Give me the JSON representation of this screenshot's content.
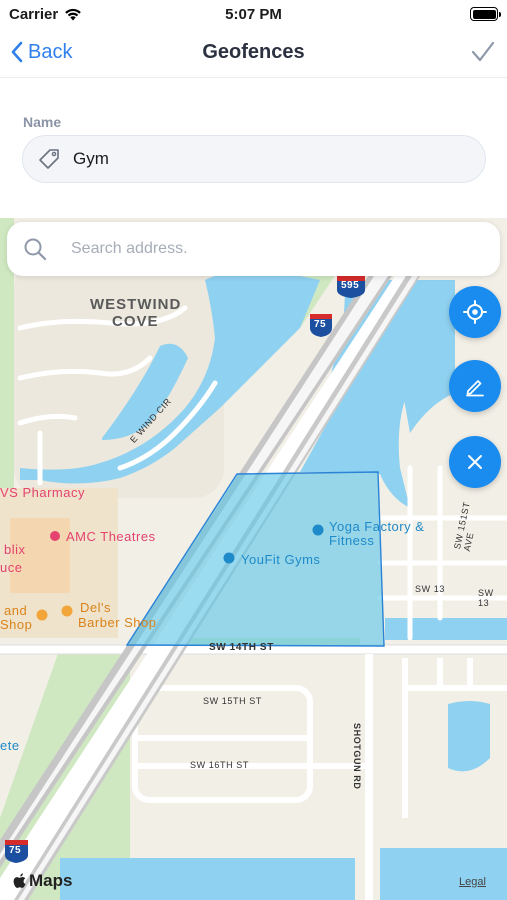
{
  "status_bar": {
    "carrier": "Carrier",
    "time": "5:07 PM"
  },
  "navbar": {
    "back_label": "Back",
    "title": "Geofences"
  },
  "form": {
    "name_label": "Name",
    "name_value": "Gym"
  },
  "search": {
    "placeholder": "Search address."
  },
  "map": {
    "area_label_1": "WESTWIND",
    "area_label_2": "COVE",
    "street_e_wind": "E WIND CIR",
    "street_14th": "SW 14TH ST",
    "street_15th": "SW 15TH ST",
    "street_16th": "SW 16TH ST",
    "street_shotgun": "SHOTGUN RD",
    "street_151st": "SW 151ST AVE",
    "street_13": "SW 13",
    "street_13_right": "SW 13",
    "poi_cvs": "VS Pharmacy",
    "poi_amc": "AMC Theatres",
    "poi_yoga_1": "Yoga Factory &",
    "poi_yoga_2": "Fitness",
    "poi_youfit": "YouFit Gyms",
    "poi_dels_1": "Del's",
    "poi_dels_2": "Barber Shop",
    "poi_publix_1": "blix",
    "poi_publix_2": "uce",
    "poi_and": "and",
    "poi_shop": "Shop",
    "poi_ete": "ete",
    "shield_595": "595",
    "shield_75_top": "75",
    "shield_75_bottom": "75",
    "attribution": "Maps",
    "legal": "Legal"
  },
  "colors": {
    "accent": "#2f80ed",
    "fab": "#1a8cef",
    "water": "#8fd1f0",
    "geofence": "#5ec7e8"
  }
}
